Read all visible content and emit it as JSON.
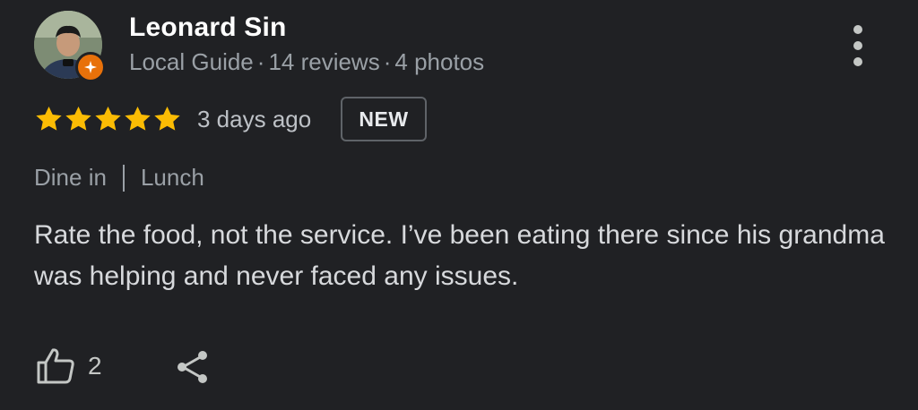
{
  "reviewer": {
    "name": "Leonard Sin",
    "badge": "Local Guide",
    "reviews": "14 reviews",
    "photos": "4 photos",
    "separator": "·"
  },
  "rating": {
    "stars": 5,
    "max": 5,
    "star_color": "#fbbc04"
  },
  "date": "3 days ago",
  "new_label": "NEW",
  "tags": [
    "Dine in",
    "Lunch"
  ],
  "review_text": "Rate the food, not the service. I’ve been eating there since his grandma was helping and never faced any issues.",
  "actions": {
    "like_count": "2",
    "like_icon": "thumbs-up-icon",
    "share_icon": "share-icon",
    "more_icon": "more-vertical-icon"
  },
  "colors": {
    "background": "#202124",
    "guide_badge": "#e8710a",
    "primary_text": "#ffffff",
    "secondary_text": "#9aa0a6"
  }
}
